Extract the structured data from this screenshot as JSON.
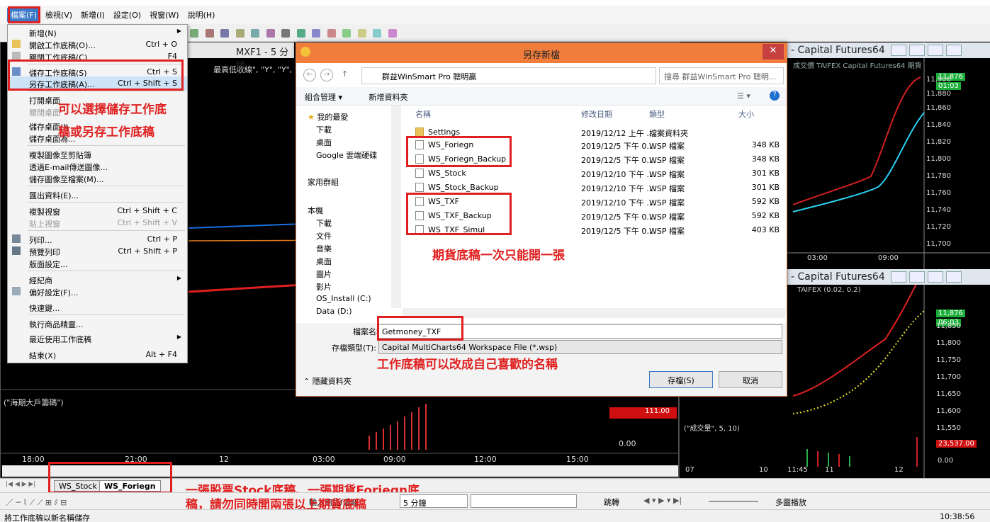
{
  "menubar": {
    "items": [
      "檔案(F)",
      "檢視(V)",
      "新增(I)",
      "設定(O)",
      "視窗(W)",
      "說明(H)"
    ]
  },
  "file_menu": {
    "items": [
      {
        "label": "新增(N)",
        "shortcut": "",
        "submenu": true
      },
      {
        "label": "開啟工作底稿(O)...",
        "shortcut": "Ctrl + O"
      },
      {
        "label": "關閉工作底稿(C)",
        "shortcut": "F4"
      },
      {
        "label": "儲存工作底稿(S)",
        "shortcut": "Ctrl + S"
      },
      {
        "label": "另存工作底稿(A)...",
        "shortcut": "Ctrl + Shift + S"
      },
      {
        "label": "打開桌面",
        "shortcut": ""
      },
      {
        "label": "關閉桌面",
        "shortcut": ""
      },
      {
        "label": "儲存桌面(I)",
        "shortcut": ""
      },
      {
        "label": "儲存桌面為...",
        "shortcut": ""
      },
      {
        "label": "複製圖像至剪貼簿",
        "shortcut": ""
      },
      {
        "label": "透過E-mail傳送圖像...",
        "shortcut": ""
      },
      {
        "label": "儲存圖像至檔案(M)...",
        "shortcut": ""
      },
      {
        "label": "匯出資料(E)...",
        "shortcut": ""
      },
      {
        "label": "複製視窗",
        "shortcut": "Ctrl + Shift + C"
      },
      {
        "label": "貼上視窗",
        "shortcut": "Ctrl + Shift + V"
      },
      {
        "label": "列印...",
        "shortcut": "Ctrl + P"
      },
      {
        "label": "預覽列印",
        "shortcut": "Ctrl + Shift + P"
      },
      {
        "label": "版面設定...",
        "shortcut": ""
      },
      {
        "label": "經紀商",
        "shortcut": "",
        "submenu": true
      },
      {
        "label": "偏好設定(F)...",
        "shortcut": ""
      },
      {
        "label": "快速鍵...",
        "shortcut": ""
      },
      {
        "label": "執行商品精靈...",
        "shortcut": ""
      },
      {
        "label": "最近使用工作底稿",
        "shortcut": "",
        "submenu": true
      },
      {
        "label": "結束(X)",
        "shortcut": "Alt + F4"
      }
    ]
  },
  "left_chart": {
    "title": "MXF1 - 5 分鐘",
    "header_fragment": "最高低收線\", \"Y\", \"Y\", \"Y\", \"Y\",",
    "sub_title": "(\"海期大戶籌碼\")",
    "red_value": "111.00",
    "zero_value": "0.00",
    "time_labels": [
      "18:00",
      "21:00",
      "12",
      "03:00",
      "09:00",
      "12:00",
      "15:00"
    ]
  },
  "right_chart_top": {
    "title": "- Capital Futures64",
    "header": "成交價 TAIFEX Capital Futures64 期貨",
    "last_price": "11,876",
    "last_time": "01:03",
    "y_ticks": [
      "11,900",
      "11,880",
      "11,860",
      "11,840",
      "11,820",
      "11,800",
      "11,780",
      "11,760",
      "11,740",
      "11,720",
      "11,700"
    ],
    "x_ticks": [
      "03:00",
      "09:00"
    ]
  },
  "right_chart_bottom": {
    "title": "- Capital Futures64",
    "header": "TAIFEX (0.02, 0.2)",
    "last_price": "11,876",
    "last_time": "06:03",
    "y_ticks": [
      "11,850",
      "11,800",
      "11,750",
      "11,700",
      "11,650",
      "11,600",
      "11,550"
    ],
    "volume_title": "(\"成交量\", 5, 10)",
    "volume_value": "23,537.00",
    "zero_value": "0.00",
    "x_ticks": [
      "07",
      "10",
      "11:45",
      "11",
      "12"
    ]
  },
  "dialog": {
    "title": "另存新檔",
    "close": "✕",
    "path": "群益WinSmart Pro 聰明贏",
    "search_placeholder": "搜尋 群益WinSmart Pro 聰明...",
    "organize": "組合管理 ▾",
    "new_folder": "新增資料夾",
    "nav": [
      "我的最愛",
      "下載",
      "桌面",
      "Google 雲端硬碟",
      "家用群組",
      "本機",
      "下載",
      "文件",
      "音樂",
      "桌面",
      "圖片",
      "影片",
      "OS_Install (C:)",
      "Data (D:)"
    ],
    "columns": [
      "名稱",
      "修改日期",
      "類型",
      "大小"
    ],
    "files": [
      {
        "name": "Settings",
        "date": "2019/12/12 上午 ...",
        "type": "檔案資料夾",
        "size": "",
        "folder": true
      },
      {
        "name": "WS_Foriegn",
        "date": "2019/12/5 下午 0...",
        "type": "WSP 檔案",
        "size": "348 KB"
      },
      {
        "name": "WS_Foriegn_Backup",
        "date": "2019/12/5 下午 0...",
        "type": "WSP 檔案",
        "size": "348 KB"
      },
      {
        "name": "WS_Stock",
        "date": "2019/12/10 下午 ...",
        "type": "WSP 檔案",
        "size": "301 KB"
      },
      {
        "name": "WS_Stock_Backup",
        "date": "2019/12/10 下午 ...",
        "type": "WSP 檔案",
        "size": "301 KB"
      },
      {
        "name": "WS_TXF",
        "date": "2019/12/10 下午 ...",
        "type": "WSP 檔案",
        "size": "592 KB"
      },
      {
        "name": "WS_TXF_Backup",
        "date": "2019/12/5 下午 0...",
        "type": "WSP 檔案",
        "size": "592 KB"
      },
      {
        "name": "WS_TXF_Simul",
        "date": "2019/12/5 下午 0...",
        "type": "WSP 檔案",
        "size": "403 KB"
      }
    ],
    "filename_label": "檔案名稱(N):",
    "filename_value": "Getmoney_TXF",
    "filetype_label": "存檔類型(T):",
    "filetype_value": "Capital MultiCharts64 Workspace File (*.wsp)",
    "hide_folders": "隱藏資料夾",
    "save": "存檔(S)",
    "cancel": "取消"
  },
  "annotations": {
    "a1": "可以選擇儲存工作底",
    "a2": "稿或另存工作底稿",
    "a3": "期貨底稿一次只能開一張",
    "a4": "工作底稿可以改成自己喜歡的名稱",
    "a5": "一張股票Stock底稿、一張期貨Foriegn底",
    "a6": "稿，請勿同時開兩張以上期貨底稿"
  },
  "sheet_tabs": [
    "WS_Stock",
    "WS_Foriegn"
  ],
  "toolbar2": {
    "interval": "5 分鐘",
    "symbol_btn": "輸入商品/週期",
    "jump": "跳轉",
    "multi_play": "多圖播放"
  },
  "status": {
    "left": "將工作底稿以新名稱儲存",
    "time": "10:38:56"
  },
  "colors": {
    "accent": "#3a78c8",
    "annotation": "#e02020",
    "dialog_title": "#f07d3c"
  }
}
